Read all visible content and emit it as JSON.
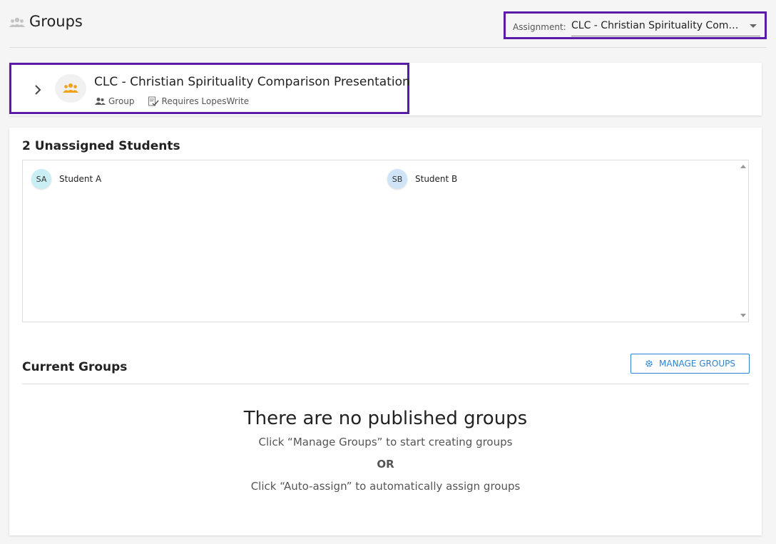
{
  "header": {
    "title": "Groups",
    "assignment_label": "Assignment:",
    "assignment_value": "CLC - Christian Spirituality Comparison Presentation"
  },
  "assignment_card": {
    "title": "CLC - Christian Spirituality Comparison Presentation",
    "type_label": "Group",
    "requirement_label": "Requires LopesWrite"
  },
  "unassigned": {
    "title": "2 Unassigned Students",
    "students": [
      {
        "initials": "SA",
        "name": "Student A",
        "color": "#c9eef3"
      },
      {
        "initials": "SB",
        "name": "Student B",
        "color": "#cfe4f6"
      }
    ]
  },
  "current_groups": {
    "title": "Current Groups",
    "manage_button": "MANAGE GROUPS",
    "empty_title": "There are no published groups",
    "empty_line1": "Click “Manage Groups” to start creating groups",
    "or_label": "OR",
    "empty_line2": "Click “Auto-assign” to automatically assign groups"
  },
  "colors": {
    "highlight": "#5a1ca8",
    "accent": "#2d84d4",
    "group_icon": "#f0a11a"
  }
}
